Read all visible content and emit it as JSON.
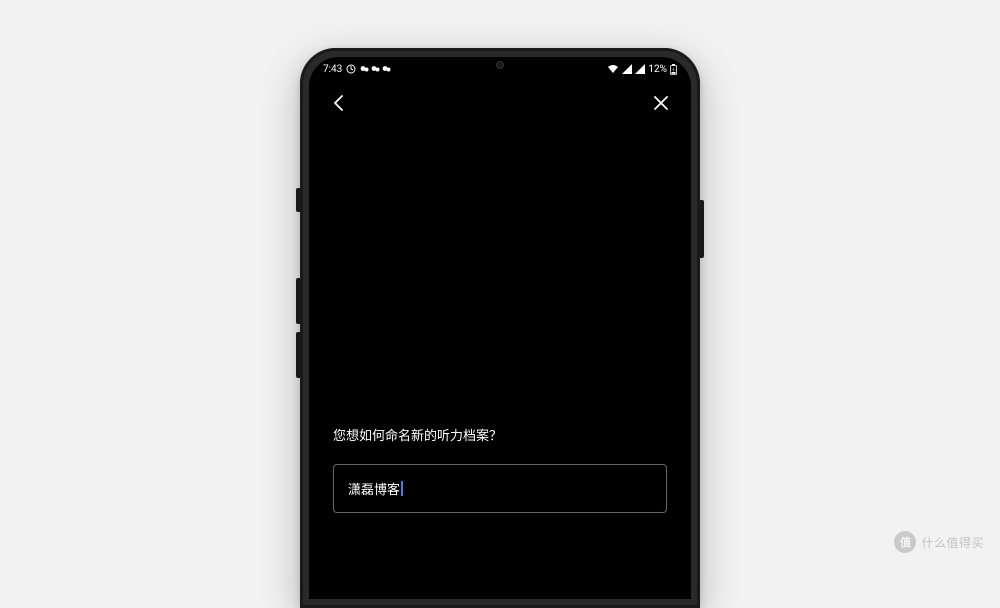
{
  "status": {
    "time": "7:43",
    "battery_percent": "12%"
  },
  "content": {
    "prompt": "您想如何命名新的听力档案？",
    "input_value": "潇磊博客"
  },
  "watermark": {
    "icon": "值",
    "text": "什么值得买"
  }
}
